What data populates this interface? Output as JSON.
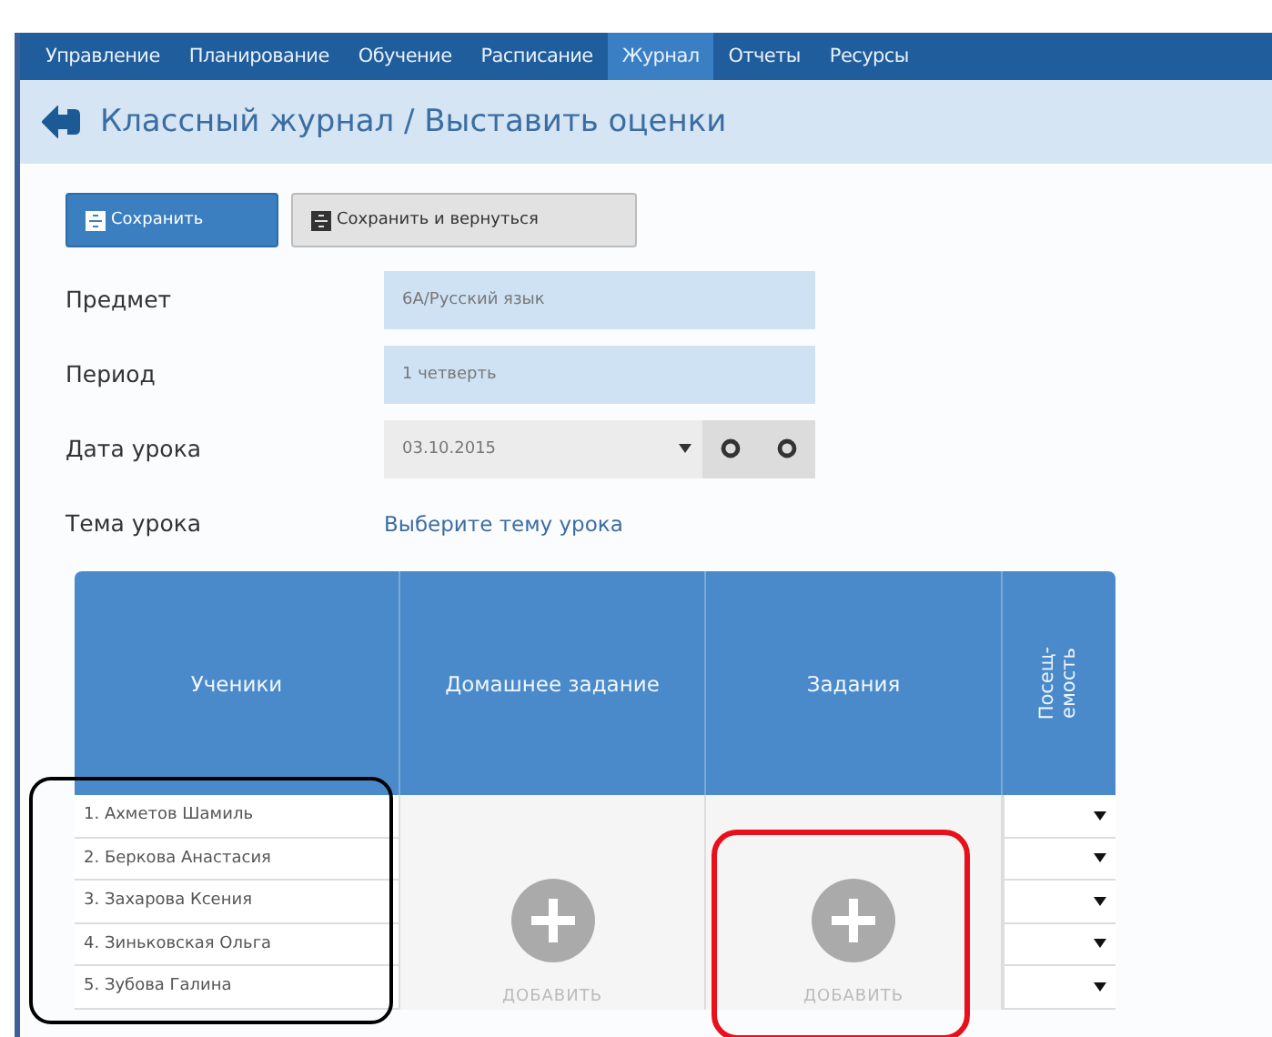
{
  "nav": {
    "items": [
      {
        "label": "Управление",
        "selected": false
      },
      {
        "label": "Планирование",
        "selected": false
      },
      {
        "label": "Обучение",
        "selected": false
      },
      {
        "label": "Расписание",
        "selected": false
      },
      {
        "label": "Журнал",
        "selected": true
      },
      {
        "label": "Отчеты",
        "selected": false
      },
      {
        "label": "Ресурсы",
        "selected": false
      }
    ]
  },
  "page_title": "Классный журнал / Выставить оценки",
  "buttons": [
    {
      "label": "Сохранить",
      "kind": "primary"
    },
    {
      "label": "Сохранить и вернуться",
      "kind": "secondary"
    }
  ],
  "fields": [
    {
      "label": "Предмет",
      "value": "6А/Русский язык",
      "kind": "text"
    },
    {
      "label": "Период",
      "value": "1 четверть",
      "kind": "text"
    },
    {
      "label": "Дата урока",
      "value": "03.10.2015",
      "kind": "date"
    },
    {
      "label": "Тема урока",
      "value": "Выберите тему урока",
      "kind": "link"
    }
  ],
  "table": {
    "columns": [
      "Ученики",
      "Домашнее задание",
      "Задания",
      "Посещ-\nемость"
    ],
    "rows": [
      "1. Ахметов Шамиль",
      "2. Беркова Анастасия",
      "3. Захарова Ксения",
      "4. Зиньковская Ольга",
      "5. Зубова Галина"
    ],
    "add_labels": [
      "ДОБАВИТЬ",
      "ДОБАВИТЬ"
    ]
  },
  "annotations": [
    {
      "kind": "students",
      "color": "#000000"
    },
    {
      "kind": "tasks",
      "color": "#e8101a"
    }
  ]
}
